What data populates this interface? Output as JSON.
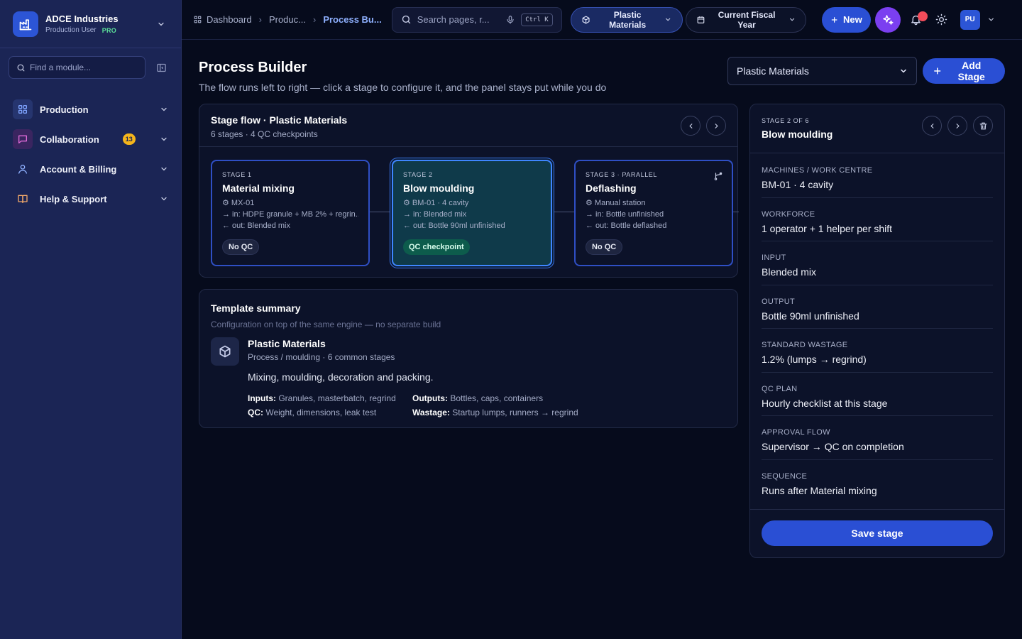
{
  "brand": {
    "name": "ADCE Industries",
    "role": "Production User",
    "plan": "PRO"
  },
  "sidebar": {
    "find_placeholder": "Find a module...",
    "items": [
      {
        "label": "Production"
      },
      {
        "label": "Collaboration",
        "badge": "13"
      },
      {
        "label": "Account & Billing"
      },
      {
        "label": "Help & Support"
      }
    ]
  },
  "topbar": {
    "breadcrumbs": [
      "Dashboard",
      "Produc...",
      "Process Bu..."
    ],
    "search_placeholder": "Search pages, r...",
    "shortcut": "Ctrl K",
    "material_pill": "Plastic Materials",
    "fiscal_pill": "Current Fiscal Year",
    "new_label": "New",
    "avatar": "PU"
  },
  "page": {
    "title": "Process Builder",
    "subtitle": "The flow runs left to right — click a stage to configure it, and the panel stays put while you do",
    "material_select": "Plastic Materials",
    "add_stage_label": "Add Stage"
  },
  "flow": {
    "title": "Stage flow · Plastic Materials",
    "subtitle": "6 stages · 4 QC checkpoints",
    "stages": [
      {
        "kicker": "Stage 1",
        "name": "Material mixing",
        "machine": "⚙ MX-01",
        "input": "→ in: HDPE granule + MB 2% + regrin...",
        "output": "← out: Blended mix",
        "qc": "No QC"
      },
      {
        "kicker": "Stage 2",
        "name": "Blow moulding",
        "machine": "⚙ BM-01 · 4 cavity",
        "input": "→ in: Blended mix",
        "output": "← out: Bottle 90ml unfinished",
        "qc": "QC checkpoint"
      },
      {
        "kicker": "Stage 3 · Parallel",
        "name": "Deflashing",
        "machine": "⚙ Manual station",
        "input": "→ in: Bottle unfinished",
        "output": "← out: Bottle deflashed",
        "qc": "No QC"
      }
    ]
  },
  "summary": {
    "title": "Template summary",
    "subtitle": "Configuration on top of the same engine — no separate build",
    "name": "Plastic Materials",
    "meta": "Process / moulding · 6 common stages",
    "description": "Mixing, moulding, decoration and packing.",
    "inputs_label": "Inputs:",
    "inputs": "Granules, masterbatch, regrind",
    "outputs_label": "Outputs:",
    "outputs": "Bottles, caps, containers",
    "qc_label": "QC:",
    "qc": "Weight, dimensions, leak test",
    "wastage_label": "Wastage:",
    "wastage": "Startup lumps, runners → regrind"
  },
  "panel": {
    "kicker": "STAGE 2 OF 6",
    "title": "Blow moulding",
    "fields": [
      {
        "label": "MACHINES / WORK CENTRE",
        "value": "BM-01 · 4 cavity"
      },
      {
        "label": "WORKFORCE",
        "value": "1 operator + 1 helper per shift"
      },
      {
        "label": "INPUT",
        "value": "Blended mix"
      },
      {
        "label": "OUTPUT",
        "value": "Bottle 90ml unfinished"
      },
      {
        "label": "STANDARD WASTAGE",
        "value": "1.2% (lumps → regrind)"
      },
      {
        "label": "QC PLAN",
        "value": "Hourly checklist at this stage"
      },
      {
        "label": "APPROVAL FLOW",
        "value": "Supervisor → QC on completion"
      },
      {
        "label": "SEQUENCE",
        "value": "Runs after Material mixing"
      }
    ],
    "save_label": "Save stage"
  },
  "colors": {
    "accent": "#2a4fd4",
    "sidebar": "#1b2555",
    "qc_checkpoint": "#0d5c4c",
    "ai": "#7b3ff0",
    "badge": "#f5b51b"
  }
}
